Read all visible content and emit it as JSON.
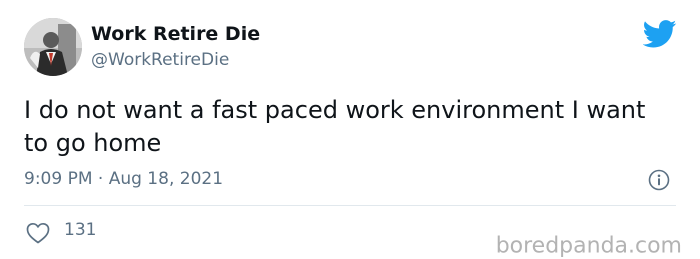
{
  "tweet": {
    "display_name": "Work Retire Die",
    "handle": "@WorkRetireDie",
    "text": "I do not want a fast paced work environment I want to go home",
    "timestamp": "9:09 PM · Aug 18, 2021",
    "like_count": "131"
  },
  "icons": {
    "brand": "twitter-bird-icon",
    "info": "info-icon",
    "like": "heart-icon"
  },
  "watermark": "boredpanda.com",
  "colors": {
    "brand_blue": "#1da1f2",
    "secondary_text": "#5b7083",
    "primary_text": "#0f1419"
  }
}
